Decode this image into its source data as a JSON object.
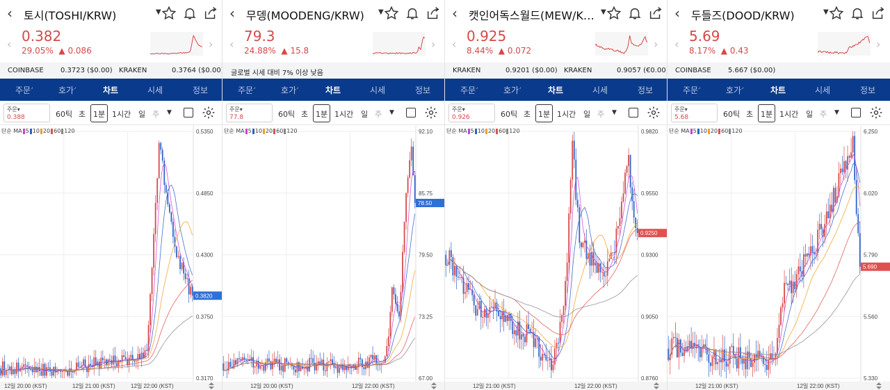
{
  "panels": [
    {
      "title": "토시(TOSHI/KRW)",
      "price": "0.382",
      "change_pct": "29.05%",
      "change_abs": "0.086",
      "exchanges": [
        {
          "name": "COINBASE",
          "value": "0.3723 ($0.00)"
        },
        {
          "name": "KRAKEN",
          "value": "0.3764 ($0.00)"
        }
      ],
      "notice": "",
      "order_label": "주문",
      "order_value": "0.388",
      "y_labels": [
        "0.5350",
        "0.4850",
        "0.4300",
        "0.3750",
        "0.3170"
      ],
      "current_tag": "0.3820",
      "x_labels": [
        "12일 20:00 (KST)",
        "12일 21:00 (KST)",
        "12일 22:00 (KST)"
      ]
    },
    {
      "title": "무뎅(MOODENG/KRW)",
      "price": "79.3",
      "change_pct": "24.88%",
      "change_abs": "15.8",
      "exchanges": [],
      "notice": "글로벌 시세 대비 7% 이상 낮음",
      "order_label": "주문",
      "order_value": "77.8",
      "y_labels": [
        "92.10",
        "85.75",
        "79.50",
        "73.25",
        "67.00"
      ],
      "current_tag": "78.50",
      "x_labels": [
        "12일 20:00 (KST)",
        "12일 22:00 (KST)"
      ]
    },
    {
      "title": "캣인어독스월드(MEW/KRW)",
      "price": "0.925",
      "change_pct": "8.44%",
      "change_abs": "0.072",
      "exchanges": [
        {
          "name": "KRAKEN",
          "value": "0.9201 ($0.00)"
        },
        {
          "name": "KRAKEN",
          "value": "0.9057 (€0.00)"
        }
      ],
      "notice": "",
      "order_label": "주문",
      "order_value": "0.926",
      "y_labels": [
        "0.9820",
        "0.9550",
        "0.9300",
        "0.9050",
        "0.8760"
      ],
      "current_tag": "0.9250",
      "x_labels": [
        "12일 21:00 (KST)",
        "12일 22:00 (KST)"
      ]
    },
    {
      "title": "두들즈(DOOD/KRW)",
      "price": "5.69",
      "change_pct": "8.17%",
      "change_abs": "0.43",
      "exchanges": [
        {
          "name": "COINBASE",
          "value": "5.667 ($0.00)"
        }
      ],
      "notice": "",
      "order_label": "주문",
      "order_value": "5.68",
      "y_labels": [
        "6.250",
        "6.020",
        "5.790",
        "5.560",
        "5.330"
      ],
      "current_tag": "5.690",
      "x_labels": [
        "12일 21:00 (KST)",
        "12일 22:00 (KST)"
      ]
    }
  ],
  "tabs": [
    {
      "label": "주문",
      "active": false
    },
    {
      "label": "호가",
      "active": false
    },
    {
      "label": "차트",
      "active": true
    },
    {
      "label": "시세",
      "active": false
    },
    {
      "label": "정보",
      "active": false
    }
  ],
  "controls": {
    "tick60": "60틱",
    "sec": "초",
    "min1": "1분",
    "hour1": "1시간",
    "day": "일",
    "week": "주"
  },
  "ma_legend": {
    "prefix": "단순 MA",
    "periods": [
      "5",
      "10",
      "20",
      "60",
      "120"
    ]
  },
  "colors": {
    "up": "#d64848",
    "down": "#2f62c8",
    "nav": "#0a3a8c",
    "tag_blue": "#2f6fd6",
    "tag_red": "#e05050"
  }
}
